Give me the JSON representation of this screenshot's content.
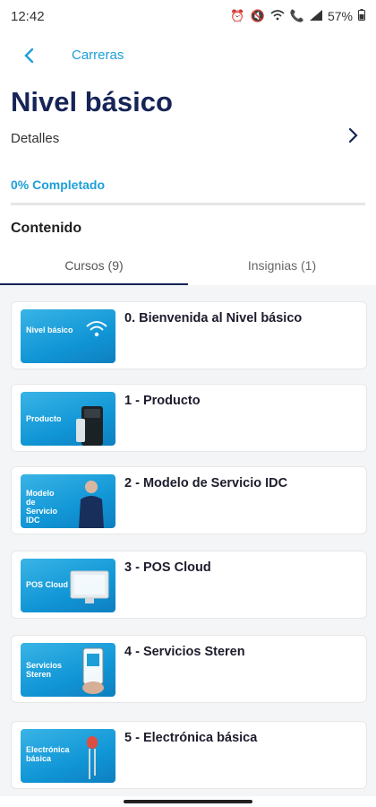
{
  "status": {
    "time": "12:42",
    "battery": "57%",
    "icons": [
      "alarm-icon",
      "mute-icon",
      "wifi-icon",
      "call-icon",
      "signal-icon"
    ]
  },
  "topbar": {
    "back_icon": "chevron-left-icon",
    "title": "Carreras"
  },
  "page": {
    "title": "Nivel básico"
  },
  "details": {
    "label": "Detalles",
    "chevron_icon": "chevron-right-icon"
  },
  "progress": {
    "label": "0% Completado",
    "value": 0
  },
  "section": {
    "title": "Contenido"
  },
  "tabs": [
    {
      "label": "Cursos (9)",
      "selected": true
    },
    {
      "label": "Insignias (1)",
      "selected": false
    }
  ],
  "courses": [
    {
      "title": "0. Bienvenida al Nivel básico",
      "thumb_label": "Nivel básico"
    },
    {
      "title": "1 - Producto",
      "thumb_label": "Producto"
    },
    {
      "title": "2 - Modelo de Servicio IDC",
      "thumb_label": "Modelo de Servicio IDC"
    },
    {
      "title": "3 - POS Cloud",
      "thumb_label": "POS Cloud"
    },
    {
      "title": "4 - Servicios Steren",
      "thumb_label": "Servicios Steren"
    },
    {
      "title": "5 - Electrónica básica",
      "thumb_label": "Electrónica básica"
    }
  ],
  "colors": {
    "accent": "#1e9fd8",
    "navy": "#162457"
  }
}
